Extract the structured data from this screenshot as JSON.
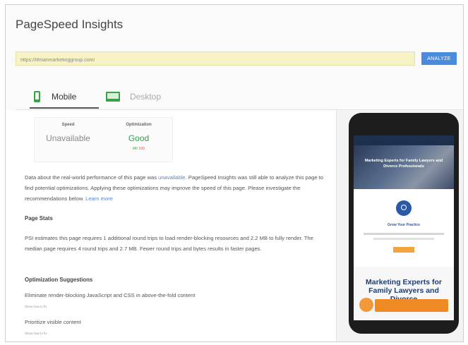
{
  "app": {
    "title": "PageSpeed Insights"
  },
  "search": {
    "url": "https://lifmanmarketinggroup.com/",
    "analyze_label": "ANALYZE"
  },
  "tabs": [
    {
      "label": "Mobile"
    },
    {
      "label": "Desktop"
    }
  ],
  "summary": {
    "speed": {
      "label": "Speed",
      "value": "Unavailable"
    },
    "optimization": {
      "label": "Optimization",
      "value": "Good",
      "sub_a": "84",
      "sub_b": "/ 100"
    }
  },
  "intro": {
    "pre": "Data about the real-world performance of this page was ",
    "link1": "unavailable",
    "post": ". PageSpeed Insights was still able to analyze this page to find potential optimizations. Applying these optimizations may improve the speed of this page. Please investigate the recommendations below. ",
    "link2": "Learn more"
  },
  "page_stats": {
    "heading": "Page Stats",
    "text": "PSI estimates this page requires 1 additional round trips to load render-blocking resources and 2.2 MB to fully render. The median page requires 4 round trips and 2.7 MB. Fewer round trips and bytes results in faster pages."
  },
  "optimization": {
    "heading": "Optimization Suggestions",
    "items": [
      {
        "title": "Eliminate render-blocking JavaScript and CSS in above-the-fold content",
        "action": "Show how to fix"
      },
      {
        "title": "Prioritize visible content",
        "action": "Show how to fix"
      }
    ]
  },
  "preview": {
    "hero_text": "Marketing Experts for Family Lawyers and Divorce Professionals",
    "section_heading": "Grow Your Practice",
    "big_text": "Marketing Experts for Family Lawyers and Divorce"
  },
  "colors": {
    "accent": "#4a8bdc",
    "good": "#2ba44a",
    "url_bg": "#f7f3c6"
  }
}
